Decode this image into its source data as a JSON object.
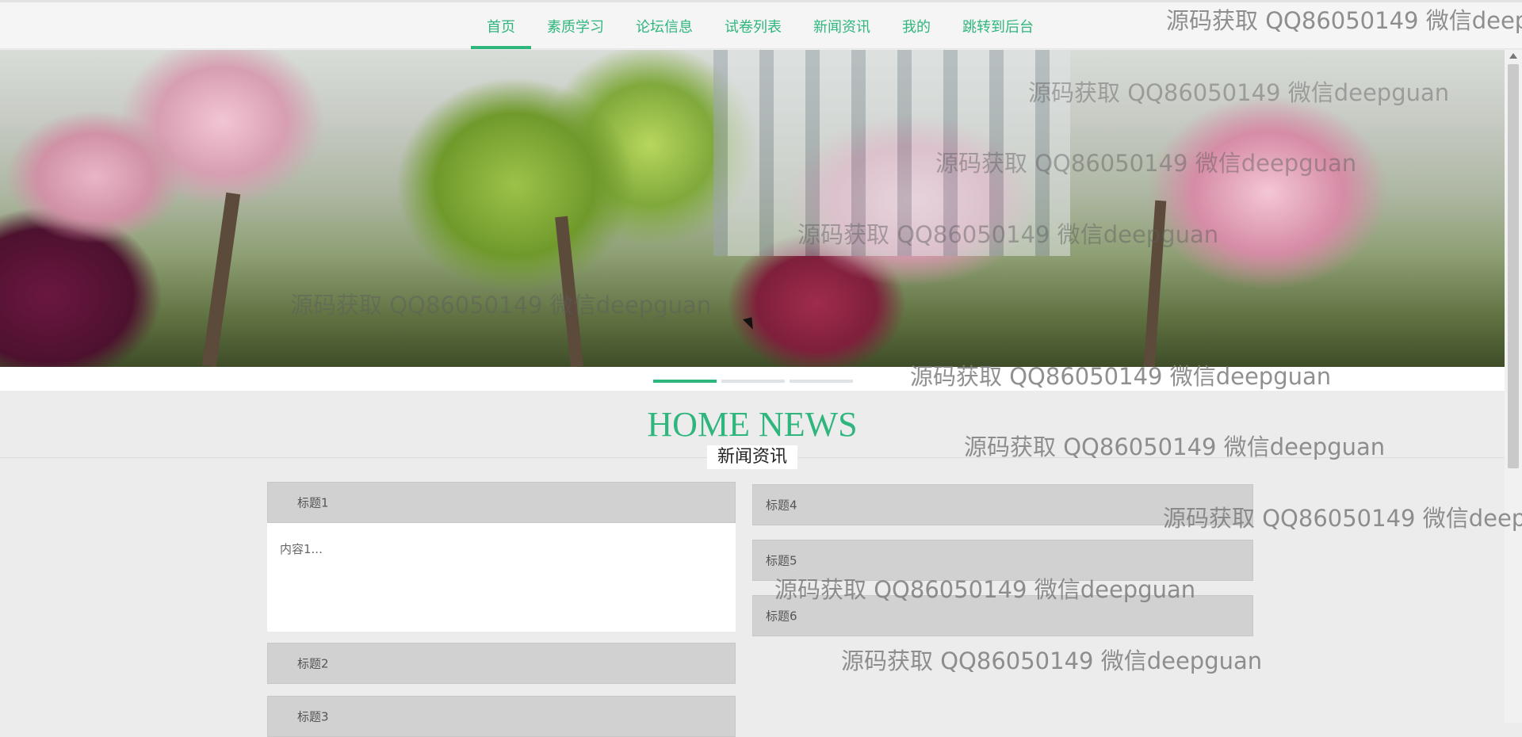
{
  "nav": {
    "items": [
      {
        "label": "首页",
        "active": true
      },
      {
        "label": "素质学习"
      },
      {
        "label": "论坛信息"
      },
      {
        "label": "试卷列表"
      },
      {
        "label": "新闻资讯"
      },
      {
        "label": "我的"
      },
      {
        "label": "跳转到后台"
      }
    ]
  },
  "watermark": {
    "text": "源码获取 QQ86050149 微信deepguan",
    "text_cut": "源码获取 QQ86050149 微信deep"
  },
  "carousel": {
    "dots": 3,
    "active_index": 0
  },
  "news": {
    "title": "HOME NEWS",
    "subtitle": "新闻资讯",
    "left": [
      {
        "title": "标题1",
        "content": "内容1..."
      },
      {
        "title": "标题2"
      },
      {
        "title": "标题3"
      }
    ],
    "right": [
      {
        "title": "标题4"
      },
      {
        "title": "标题5"
      },
      {
        "title": "标题6"
      }
    ]
  },
  "colors": {
    "accent": "#2fb67d",
    "page_bg": "#ececec",
    "panel_header": "#d1d1d1"
  }
}
